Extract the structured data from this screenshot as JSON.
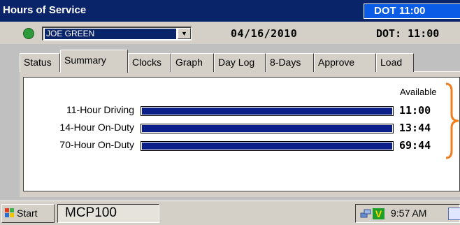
{
  "window": {
    "title": "Hours of Service",
    "dot_badge": "DOT 11:00"
  },
  "driver": {
    "status_color": "#2e9b3a",
    "name": "JOE GREEN",
    "date": "04/16/2010",
    "dot_clock": "DOT: 11:00"
  },
  "tabs": [
    {
      "label": "Status",
      "active": false
    },
    {
      "label": "Summary",
      "active": true
    },
    {
      "label": "Clocks",
      "active": false
    },
    {
      "label": "Graph",
      "active": false
    },
    {
      "label": "Day Log",
      "active": false
    },
    {
      "label": "8-Days",
      "active": false
    },
    {
      "label": "Approve",
      "active": false
    },
    {
      "label": "Load",
      "active": false
    }
  ],
  "summary": {
    "available_label": "Available",
    "rows": [
      {
        "label": "11-Hour Driving",
        "value": "11:00",
        "fraction": 1.0
      },
      {
        "label": "14-Hour On-Duty",
        "value": "13:44",
        "fraction": 1.0
      },
      {
        "label": "70-Hour On-Duty",
        "value": "69:44",
        "fraction": 1.0
      }
    ],
    "bar_color": "#0b1f8a",
    "brace_color": "#f07d1e"
  },
  "taskbar": {
    "start_label": "Start",
    "app_label": "MCP100",
    "clock": "9:57 AM",
    "tray_icons": [
      "network-icon",
      "v-app-icon",
      "desktop-icon"
    ]
  }
}
